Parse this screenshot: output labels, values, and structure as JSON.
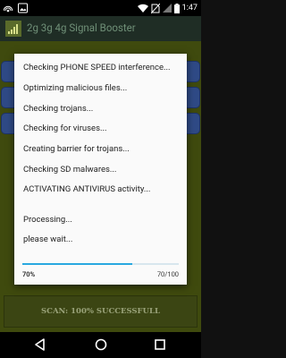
{
  "status_bar": {
    "time": "1:47",
    "icons": [
      "hotspot-icon",
      "photo-icon",
      "wifi-icon",
      "no-sim-icon",
      "signal-icon",
      "battery-icon"
    ]
  },
  "app_bar": {
    "title": "2g 3g 4g Signal Booster",
    "icon": "signal-bars-icon"
  },
  "colors": {
    "status_bar": "#000000",
    "app_bar": "#1f2d25",
    "app_background": "#3f4a0e",
    "blue_buttons": "#2f4a86",
    "progress_accent": "#29a8e0"
  },
  "dialog": {
    "lines": [
      "Checking PHONE SPEED interference...",
      "Optimizing malicious files...",
      "Checking trojans...",
      "Checking for viruses...",
      "Creating barrier for trojans...",
      "Checking SD malwares...",
      "ACTIVATING ANTIVIRUS activity..."
    ],
    "processing": "Processing...",
    "wait": "please wait...",
    "progress": {
      "value": 70,
      "max": 100,
      "percent_label": "70%",
      "count_label": "70/100"
    }
  },
  "scan_button": {
    "label": "SCAN: 100% SUCCESSFULL"
  },
  "nav_bar": {
    "buttons": [
      "back-icon",
      "home-icon",
      "recents-icon"
    ]
  }
}
